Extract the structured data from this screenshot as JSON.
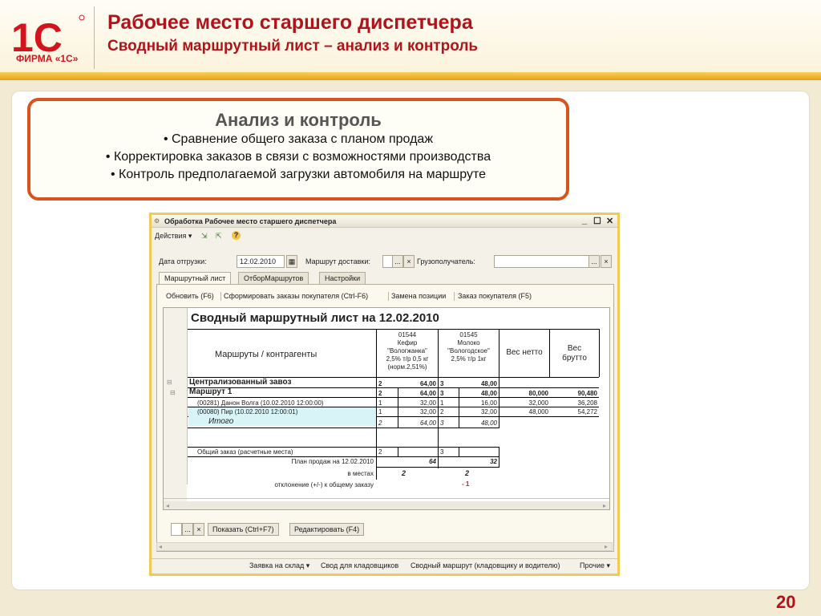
{
  "header": {
    "logo_text": "1С",
    "logo_caption": "ФИРМА «1С»",
    "title": "Рабочее место старшего диспетчера",
    "subtitle": "Сводный маршрутный лист – анализ и контроль"
  },
  "callout": {
    "title": "Анализ и контроль",
    "lines": [
      "• Сравнение общего заказа с планом продаж",
      "• Корректировка заказов в связи с возможностями производства",
      "•  Контроль предполагаемой загрузки автомобиля на маршруте"
    ]
  },
  "window": {
    "title": "Обработка  Рабочее место старшего диспетчера",
    "controls": {
      "minimize": "_",
      "maximize": "☐",
      "close": "✕"
    },
    "toolbar": {
      "actions": "Действия ▾",
      "help": "?"
    },
    "form": {
      "date_label": "Дата отгрузки:",
      "date_value": "12.02.2010",
      "route_label": "Маршрут доставки:",
      "route_value": "",
      "consignee_label": "Грузополучатель:",
      "consignee_value": "",
      "dots": "...",
      "clear": "×"
    },
    "tabs": [
      "Маршрутный лист",
      "ОтборМаршрутов",
      "Настройки"
    ],
    "sub_toolbar": [
      "Обновить (F6)",
      "Сформировать заказы покупателя (Ctrl-F6)",
      "Замена позиции",
      "Заказ покупателя (F5)"
    ],
    "sheet": {
      "title": "Сводный маршрутный лист  на  12.02.2010",
      "col_header": "Маршруты / контрагенты",
      "product1": [
        "01544",
        "Кефир",
        "\"Вологжанка\"",
        "2,5% т/р 0,5 кг",
        "(норм.2,51%)"
      ],
      "product2": [
        "01545",
        "Молоко",
        "\"Вологодское\"",
        "2,5% т/р 1кг"
      ],
      "net_header": [
        "Вес нетто"
      ],
      "gross_header": [
        "Вес",
        "брутто"
      ],
      "tree_minus": "⊟",
      "rows": [
        {
          "name": "Централизованный завоз",
          "q1": "2",
          "v1": "64,00",
          "q2": "3",
          "v2": "48,00",
          "net": "",
          "gross": ""
        },
        {
          "name": "Маршрут 1",
          "q1": "2",
          "v1": "64,00",
          "q2": "3",
          "v2": "48,00",
          "net": "80,000",
          "gross": "90,480"
        },
        {
          "name": "(00281) Данон Волга (10.02.2010 12:00:00)",
          "q1": "1",
          "v1": "32,00",
          "q2": "1",
          "v2": "16,00",
          "net": "32,000",
          "gross": "36,208"
        },
        {
          "name": "(00080) Пир (10.02.2010 12:00:01)",
          "q1": "1",
          "v1": "32,00",
          "q2": "2",
          "v2": "32,00",
          "net": "48,000",
          "gross": "54,272"
        },
        {
          "name": "Итого",
          "q1": "2",
          "v1": "64,00",
          "q2": "3",
          "v2": "48,00",
          "net": "",
          "gross": ""
        }
      ],
      "total_order_label": "Общий заказ (расчетные места)",
      "total_order_q1": "2",
      "total_order_q2": "3",
      "sales_plan_label": "План продаж на 12.02.2010",
      "sales_plan_v1": "64",
      "sales_plan_v2": "32",
      "in_places_label": "в местах",
      "in_places_v1": "2",
      "in_places_v2": "2",
      "deviation_label": "отклонение (+/-) к общему заказу",
      "deviation_v2": "- 1"
    },
    "bottom": {
      "dots": "...",
      "clear": "×",
      "show": "Показать (Ctrl+F7)",
      "edit": "Редактировать (F4)"
    },
    "statusbar": [
      "Заявка на склад ▾",
      "Свод для кладовщиков",
      "Сводный маршрут (кладовщику и водителю)",
      "Прочие ▾"
    ]
  },
  "page_number": "20",
  "colors": {
    "brand_red": "#b0141a",
    "accent_orange": "#d8541e",
    "gold": "#f0ca54"
  }
}
